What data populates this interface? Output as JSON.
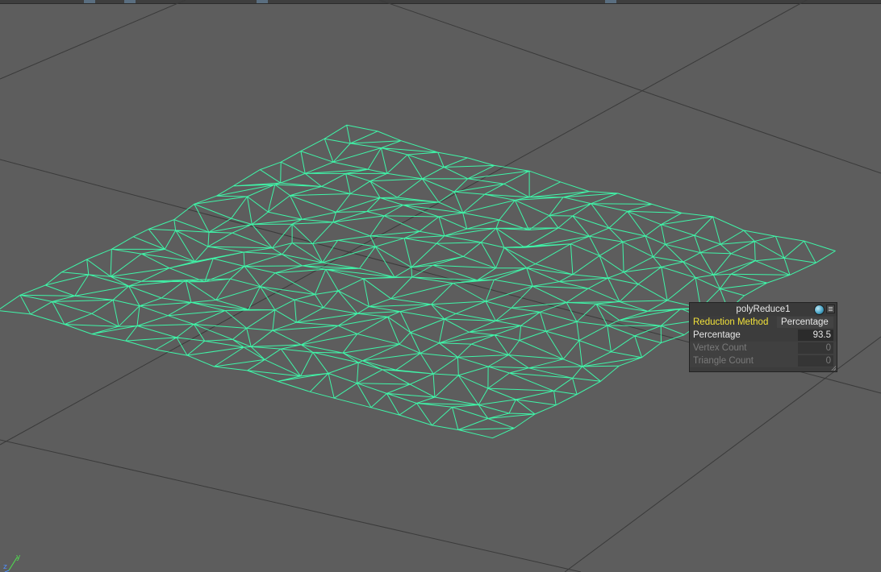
{
  "viewport": {
    "background": "#5d5d5d",
    "grid_color": "#3a3a3a",
    "wire_color": "#3ff5a8"
  },
  "hud": {
    "title": "polyReduce1",
    "icons": [
      "orb-icon",
      "menu-icon"
    ],
    "rows": [
      {
        "label": "Reduction Method",
        "value": "Percentage",
        "state": "highlighted"
      },
      {
        "label": "Percentage",
        "value": "93.5",
        "state": "active"
      },
      {
        "label": "Vertex Count",
        "value": "0",
        "state": "disabled"
      },
      {
        "label": "Triangle Count",
        "value": "0",
        "state": "disabled"
      }
    ]
  },
  "axis_indicator": {
    "labels": {
      "y": "y",
      "z": "z"
    },
    "colors": {
      "y": "#4fe04f",
      "z": "#4f8fff"
    }
  }
}
